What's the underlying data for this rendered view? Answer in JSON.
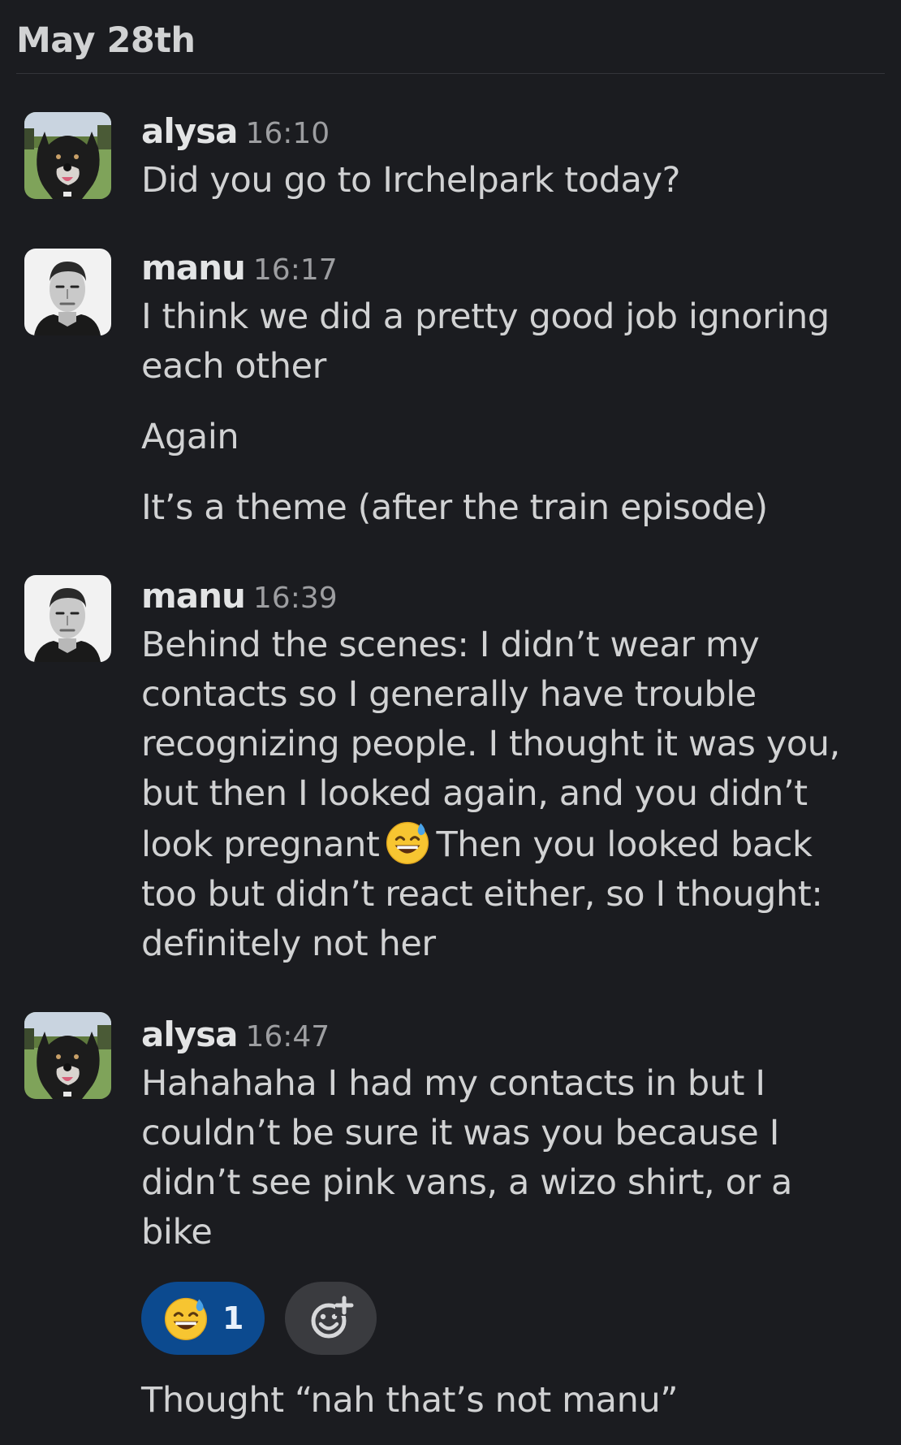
{
  "date_divider": "May 28th",
  "messages": [
    {
      "author": "alysa",
      "time": "16:10",
      "avatar": "dog-photo",
      "lines": [
        "Did you go to Irchelpark today?"
      ]
    },
    {
      "author": "manu",
      "time": "16:17",
      "avatar": "man-portrait-photo",
      "lines": [
        "I think we did a pretty good job ignoring",
        "each other"
      ],
      "followups": [
        "Again",
        "It’s a theme (after the train episode)"
      ]
    },
    {
      "author": "manu",
      "time": "16:39",
      "avatar": "man-portrait-photo",
      "lines": [
        "Behind the scenes: I didn’t wear my",
        "contacts so I generally have trouble",
        "recognizing people. I thought it was you,",
        "but then I looked again, and you didn’t"
      ],
      "line5_before": "look pregnant",
      "line5_emoji": "grinning-sweat-emoji",
      "line5_after": "Then you looked back",
      "lines_tail": [
        "too but didn’t react either, so I thought:",
        "definitely not her"
      ]
    },
    {
      "author": "alysa",
      "time": "16:47",
      "avatar": "dog-photo",
      "lines": [
        "Hahahaha I had my contacts in but I",
        "couldn’t be sure it was you because I",
        "didn’t see pink vans, a wizo shirt, or a",
        "bike"
      ],
      "reaction": {
        "emoji": "grinning-sweat-emoji",
        "count": "1"
      },
      "add_reaction_icon": "add-reaction-icon",
      "followups": [
        "Thought “nah that’s not manu”"
      ]
    }
  ],
  "colors": {
    "background": "#1b1c20",
    "text": "#d1d2d3",
    "timestamp": "#9d9ea1",
    "reaction_active": "#0c4a8f",
    "reaction_add": "#3a3b3f"
  }
}
